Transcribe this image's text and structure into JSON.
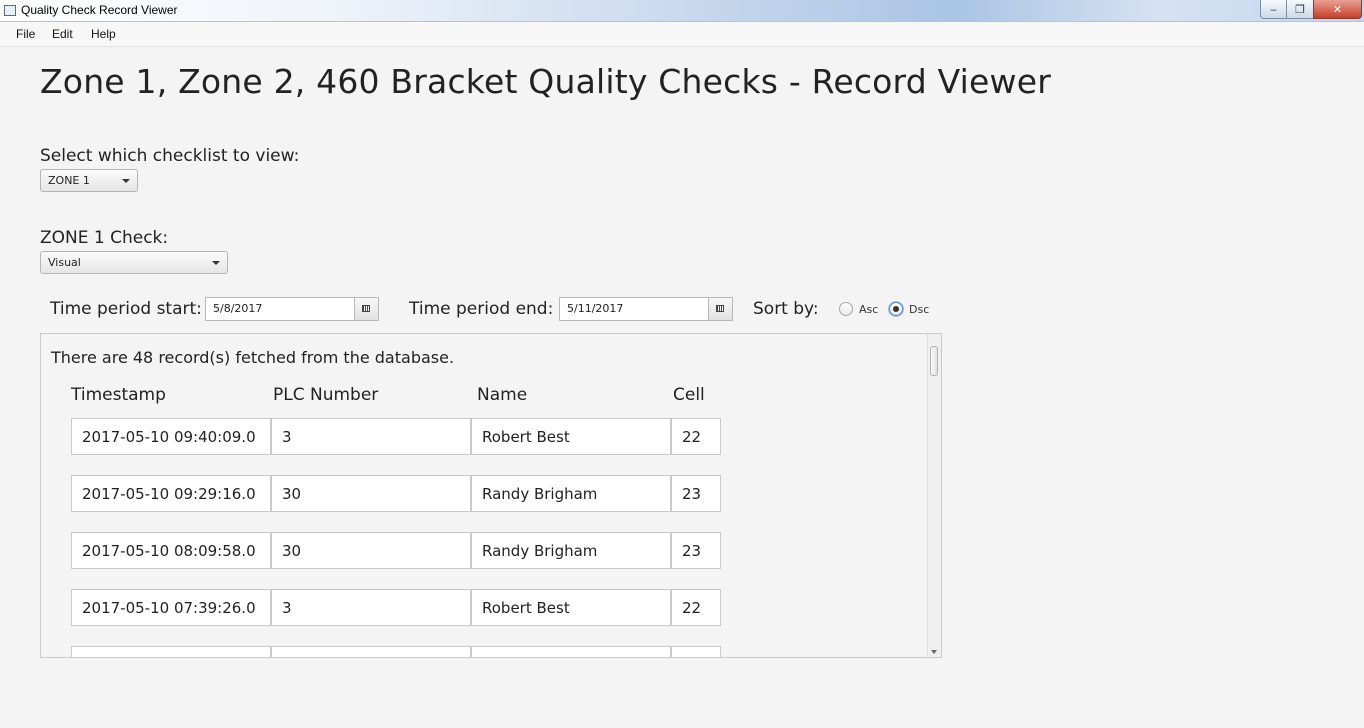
{
  "window": {
    "title": "Quality Check Record Viewer",
    "controls": {
      "minimize": "‒",
      "maximize": "❐",
      "close": "✕"
    }
  },
  "menu": [
    "File",
    "Edit",
    "Help"
  ],
  "heading": "Zone 1, Zone 2, 460 Bracket Quality Checks - Record Viewer",
  "checklist": {
    "label": "Select which checklist to view:",
    "selected": "ZONE 1"
  },
  "check": {
    "label": "ZONE 1 Check:",
    "selected": "Visual"
  },
  "period": {
    "start_label": "Time period start:",
    "start_value": "5/8/2017",
    "end_label": "Time period end:",
    "end_value": "5/11/2017"
  },
  "sort": {
    "label": "Sort by:",
    "asc_label": "Asc",
    "dsc_label": "Dsc",
    "selected": "Dsc"
  },
  "records": {
    "message": "There are 48 record(s) fetched from the database.",
    "columns": [
      "Timestamp",
      "PLC Number",
      "Name",
      "Cell"
    ],
    "rows": [
      [
        "2017-05-10 09:40:09.0",
        "3",
        "Robert Best",
        "22"
      ],
      [
        "2017-05-10 09:29:16.0",
        "30",
        "Randy Brigham",
        "23"
      ],
      [
        "2017-05-10 08:09:58.0",
        "30",
        "Randy Brigham",
        "23"
      ],
      [
        "2017-05-10 07:39:26.0",
        "3",
        "Robert Best",
        "22"
      ],
      [
        "",
        "",
        "",
        ""
      ]
    ]
  }
}
